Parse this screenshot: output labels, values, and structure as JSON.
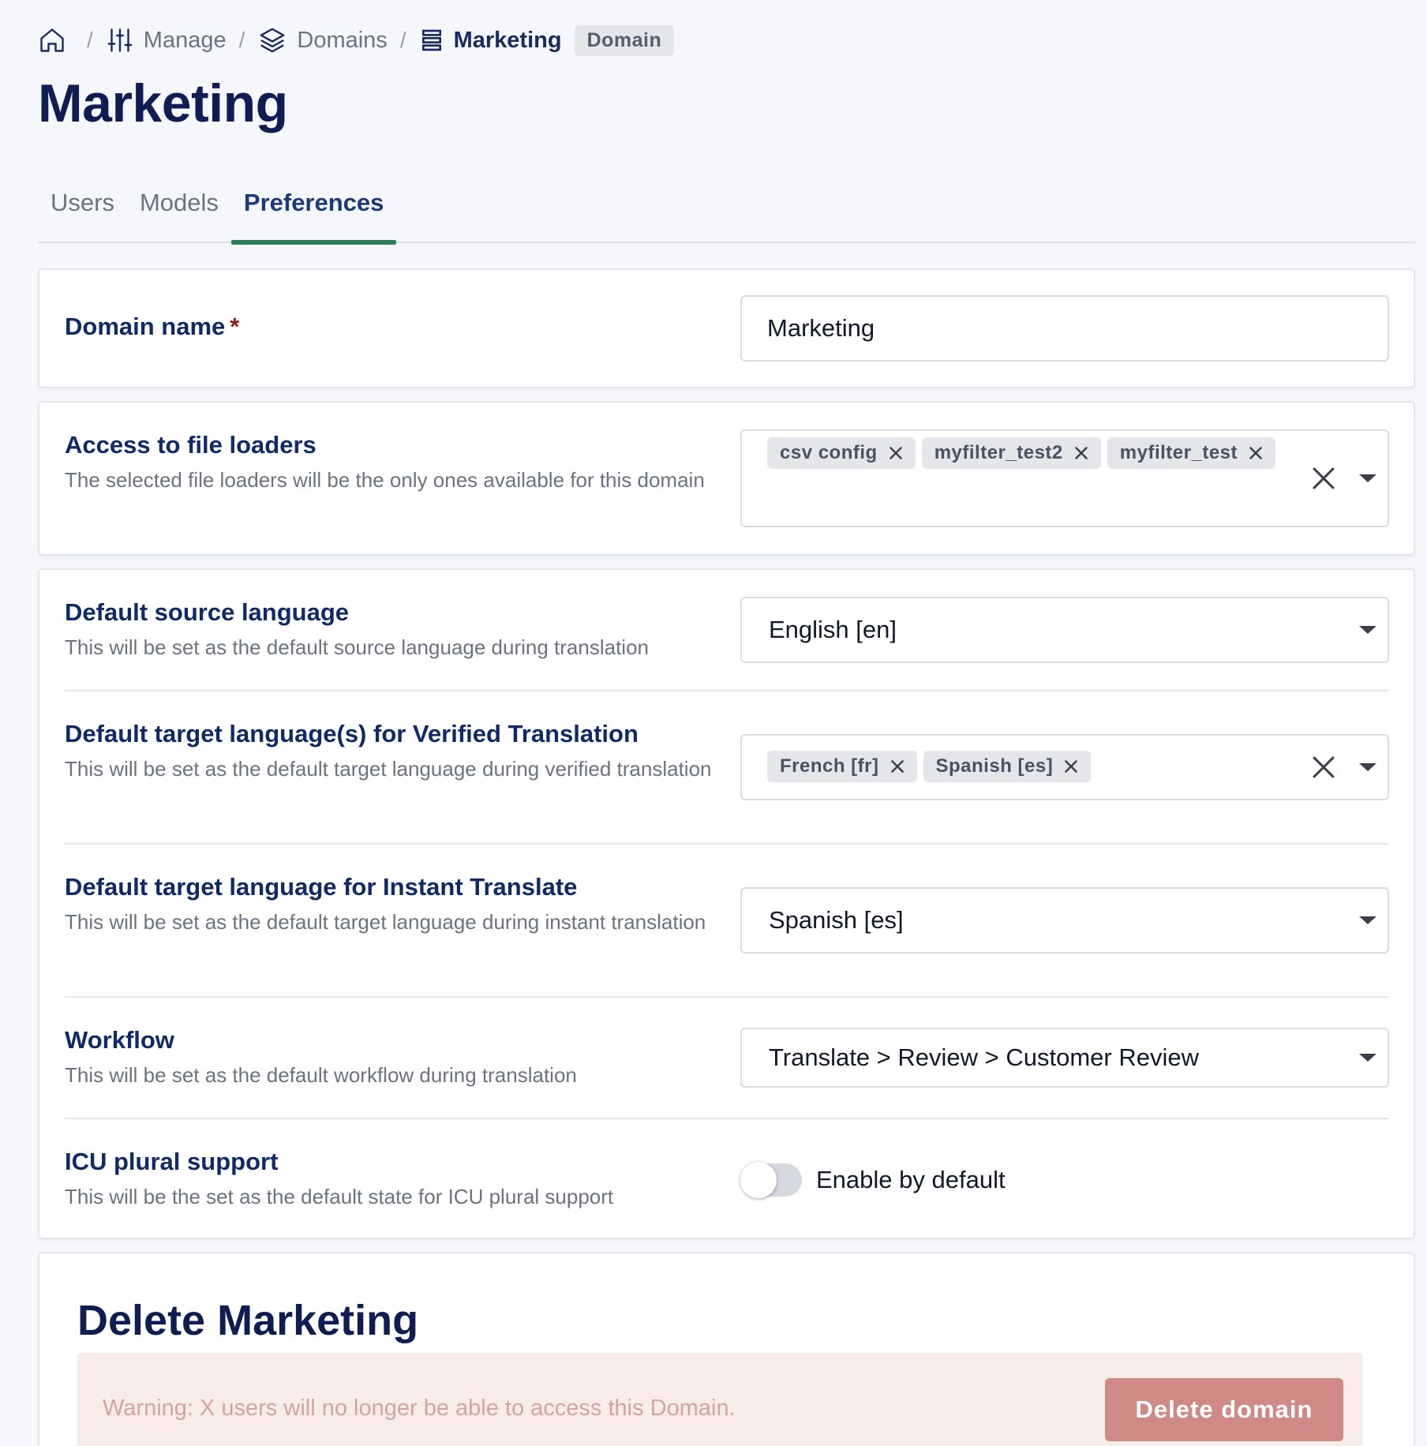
{
  "breadcrumb": {
    "separator": "/",
    "manage": "Manage",
    "domains": "Domains",
    "current": "Marketing",
    "badge": "Domain"
  },
  "page_title": "Marketing",
  "tabs": [
    {
      "label": "Users",
      "active": false
    },
    {
      "label": "Models",
      "active": false
    },
    {
      "label": "Preferences",
      "active": true
    }
  ],
  "domain_name": {
    "label": "Domain name",
    "required_mark": "*",
    "value": "Marketing"
  },
  "file_loaders": {
    "label": "Access to file loaders",
    "description": "The selected file loaders will be the only ones available for this domain",
    "chips": [
      "csv config",
      "myfilter_test2",
      "myfilter_test"
    ]
  },
  "source_language": {
    "label": "Default source language",
    "description": "This will be set as the default source language during translation",
    "value": "English [en]"
  },
  "target_languages_verified": {
    "label": "Default target language(s) for Verified Translation",
    "description": "This will be set as the default target language during verified translation",
    "chips": [
      "French [fr]",
      "Spanish [es]"
    ]
  },
  "target_language_instant": {
    "label": "Default target language for Instant Translate",
    "description": "This will be set as the default target language during instant translation",
    "value": "Spanish [es]"
  },
  "workflow": {
    "label": "Workflow",
    "description": "This will be set as the default workflow during translation",
    "value": "Translate > Review > Customer Review"
  },
  "icu_plural": {
    "label": "ICU plural support",
    "description": "This will be the set as the default state for ICU plural support",
    "toggle_label": "Enable by default",
    "enabled": false
  },
  "delete_section": {
    "title": "Delete Marketing",
    "warning": "Warning: X users will no longer be able to access this Domain.",
    "button": "Delete domain"
  },
  "colors": {
    "accent_tab": "#2e7d5b",
    "heading": "#0f1d52",
    "danger_button": "#cf8a86",
    "warning_bg": "#f8eceb"
  }
}
